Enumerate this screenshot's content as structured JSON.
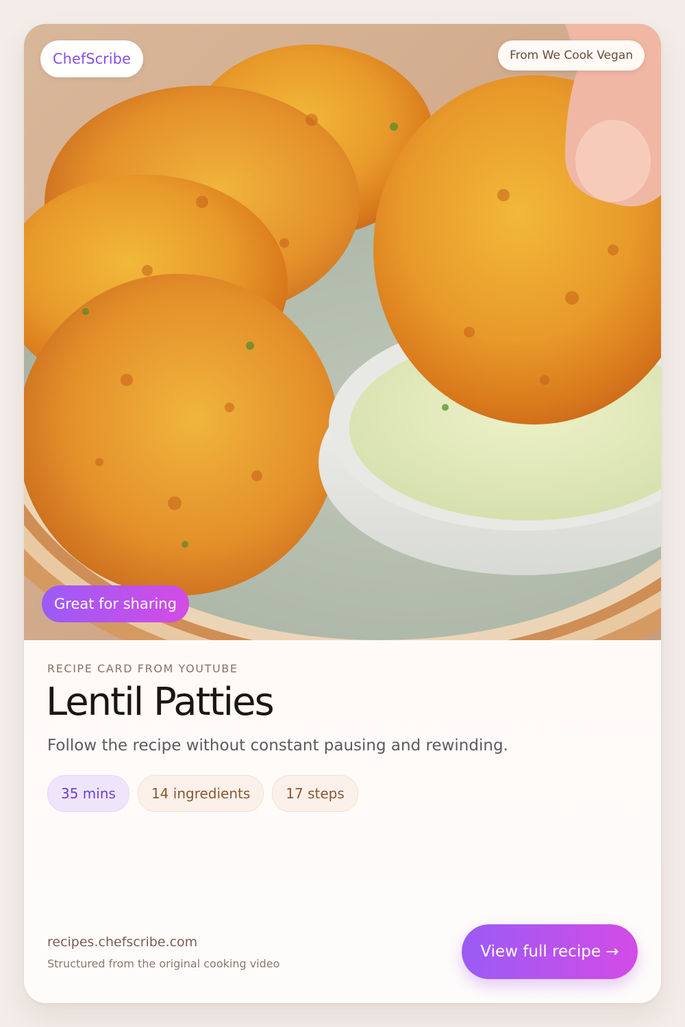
{
  "brand": {
    "name": "ChefScribe"
  },
  "hero": {
    "source_label": "From We Cook Vegan",
    "tag": "Great for sharing"
  },
  "recipe": {
    "eyebrow": "RECIPE CARD FROM YOUTUBE",
    "title": "Lentil Patties",
    "subtitle": "Follow the recipe without constant pausing and rewinding.",
    "chips": {
      "time": "35 mins",
      "ingredients": "14 ingredients",
      "steps": "17 steps"
    }
  },
  "footer": {
    "site": "recipes.chefscribe.com",
    "tagline": "Structured from the original cooking video",
    "cta_label": "View full recipe →"
  },
  "colors": {
    "accent_start": "#9b5bf5",
    "accent_end": "#d44be6",
    "brand_text": "#8a4ee8"
  }
}
